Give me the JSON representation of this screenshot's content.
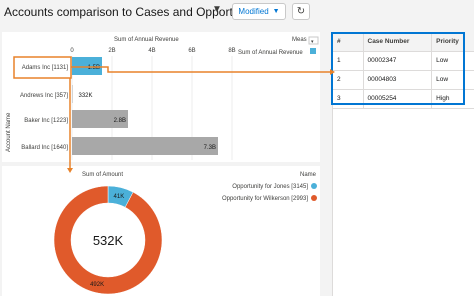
{
  "header": {
    "title": "Accounts comparison to Cases and Opportunities",
    "modified_label": "Modified",
    "caret_icon": "chevron-down-icon",
    "refresh_icon": "refresh-icon"
  },
  "bar_chart": {
    "title": "Sum of Annual Revenue",
    "legend_header": "Meas",
    "legend_item": "Sum of Annual Revenue",
    "ylabel": "Account Name",
    "tick_labels": [
      "0",
      "2B",
      "4B",
      "6B",
      "8B"
    ]
  },
  "chart_data": [
    {
      "type": "bar",
      "orientation": "horizontal",
      "title": "Sum of Annual Revenue",
      "ylabel": "Account Name",
      "categories": [
        "Adams Inc [1131]",
        "Andrews Inc [357]",
        "Baker Inc [1223]",
        "Ballard Inc [1640]"
      ],
      "values": [
        1.5,
        0.000332,
        2.8,
        7.3
      ],
      "value_labels": [
        "1.5B",
        "332K",
        "2.8B",
        "7.3B"
      ],
      "xlim": [
        0,
        9
      ],
      "ticks": [
        0,
        2,
        4,
        6,
        8
      ],
      "colors": {
        "selected": "#4bb0d9",
        "default": "#a8a8a8"
      },
      "selected_index": 0
    },
    {
      "type": "pie",
      "donut": true,
      "title": "Sum of Amount",
      "center_label": "532K",
      "legend_title": "Name",
      "labels": [
        "Opportunity for Jones [3145]",
        "Opportunity for Wilkerson [2993]"
      ],
      "values": [
        41,
        492
      ],
      "value_labels": [
        "41K",
        "492K"
      ],
      "colors": [
        "#4bb0d9",
        "#e05a2b"
      ]
    }
  ],
  "table": {
    "headers": [
      "#",
      "Case Number",
      "Priority"
    ],
    "rows": [
      [
        "1",
        "00002347",
        "Low"
      ],
      [
        "2",
        "00004803",
        "Low"
      ],
      [
        "3",
        "00005254",
        "High"
      ]
    ]
  },
  "colors": {
    "accent": "#0176d3",
    "connector": "#e8822a"
  }
}
